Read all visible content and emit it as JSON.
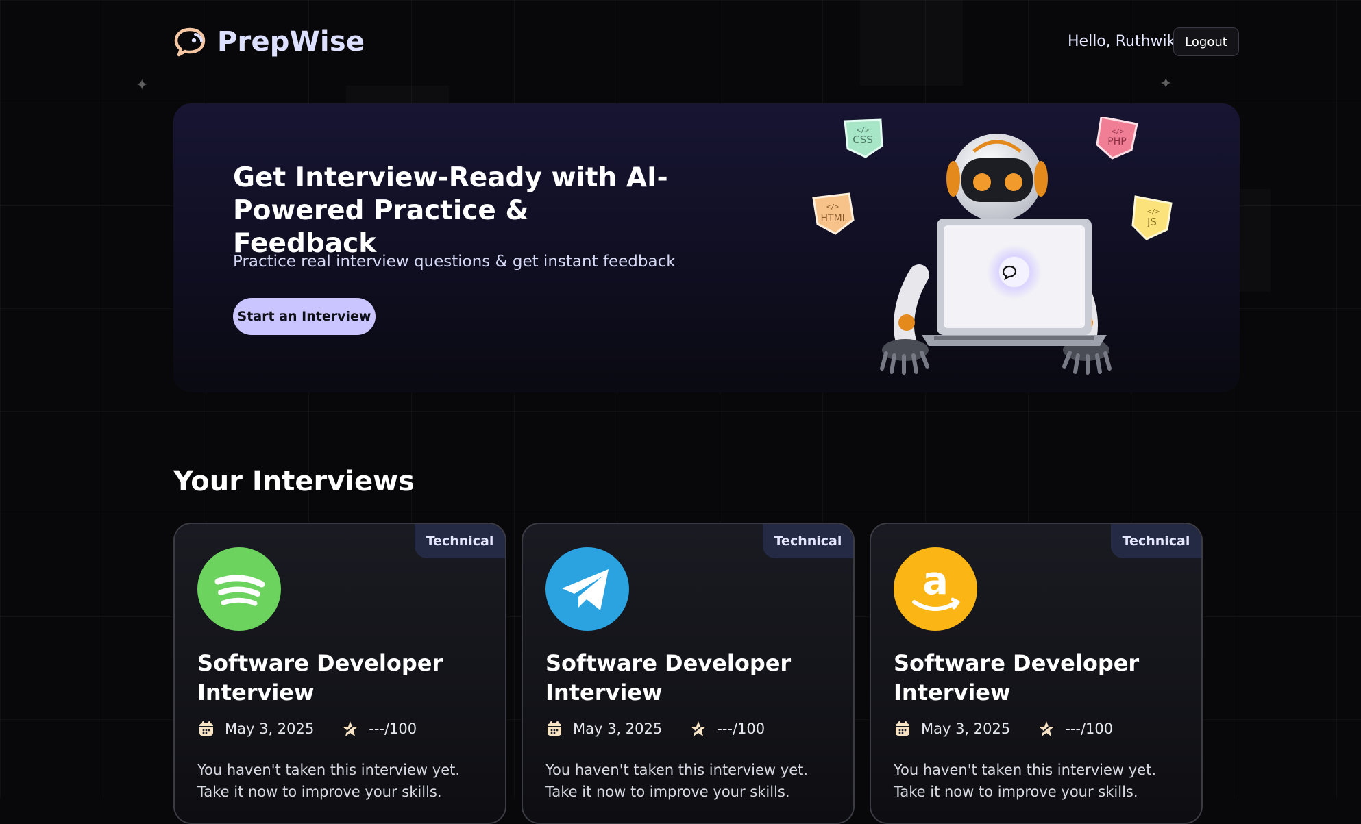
{
  "header": {
    "brand": "PrepWise",
    "greeting": "Hello, Ruthwik",
    "logout_label": "Logout"
  },
  "hero": {
    "title": "Get Interview-Ready with AI-Powered Practice & Feedback",
    "subtitle": "Practice real interview questions & get instant feedback",
    "cta_label": "Start an Interview",
    "tags": [
      "CSS",
      "PHP",
      "HTML",
      "JS"
    ]
  },
  "section": {
    "title": "Your Interviews"
  },
  "cards": [
    {
      "badge": "Technical",
      "company_icon": "spotify-logo",
      "title": "Software Developer Interview",
      "date": "May 3, 2025",
      "score": "---/100",
      "description": "You haven't taken this interview yet. Take it now to improve your skills."
    },
    {
      "badge": "Technical",
      "company_icon": "telegram-logo",
      "title": "Software Developer Interview",
      "date": "May 3, 2025",
      "score": "---/100",
      "description": "You haven't taken this interview yet. Take it now to improve your skills."
    },
    {
      "badge": "Technical",
      "company_icon": "amazon-logo",
      "title": "Software Developer Interview",
      "date": "May 3, 2025",
      "score": "---/100",
      "description": "You haven't taken this interview yet. Take it now to improve your skills."
    }
  ],
  "colors": {
    "accent": "#cac5fe",
    "background": "#08080a",
    "badge": "#252a44"
  }
}
